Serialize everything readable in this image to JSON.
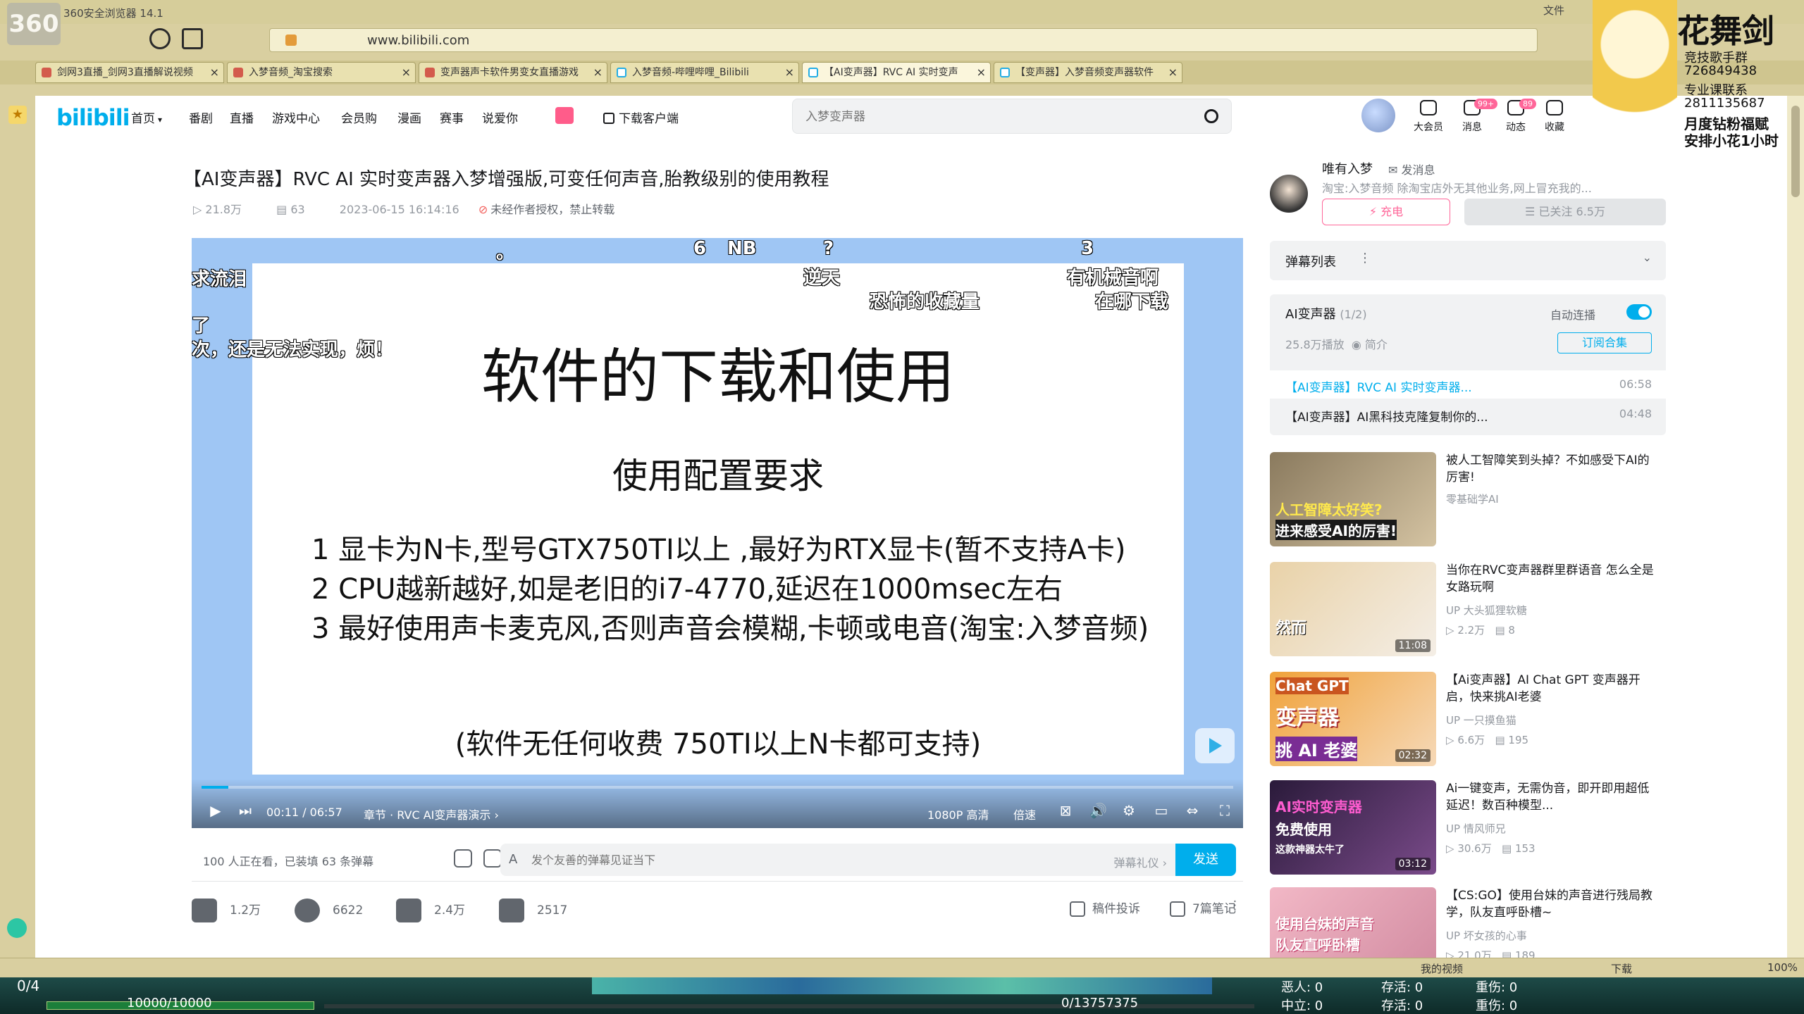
{
  "browser": {
    "app_title": "360安全浏览器 14.1",
    "url": "www.bilibili.com",
    "menu_file": "文件",
    "tabs": [
      {
        "label": "剑网3直播_剑网3直播解说视频"
      },
      {
        "label": "入梦音频_淘宝搜索"
      },
      {
        "label": "变声器声卡软件男变女直播游戏"
      },
      {
        "label": "入梦音频-哔哩哔哩_Bilibili"
      },
      {
        "label": "【AI变声器】RVC AI 实时变声"
      },
      {
        "label": "【变声器】入梦音频变声器软件"
      }
    ],
    "status_my_video": "我的视频",
    "status_download": "下载",
    "zoom": "100%"
  },
  "header": {
    "logo": "bilibili",
    "nav": [
      "首页",
      "番剧",
      "直播",
      "游戏中心",
      "会员购",
      "漫画",
      "赛事",
      "说爱你"
    ],
    "download_client": "下载客户端",
    "search_placeholder": "入梦变声器",
    "icons": [
      {
        "label": "大会员",
        "badge": ""
      },
      {
        "label": "消息",
        "badge": "99+"
      },
      {
        "label": "动态",
        "badge": "89"
      },
      {
        "label": "收藏",
        "badge": ""
      }
    ]
  },
  "video": {
    "title": "【AI变声器】RVC AI 实时变声器入梦增强版,可变任何声音,胎教级别的使用教程",
    "views": "21.8万",
    "danmaku_count": "63",
    "date": "2023-06-15 16:14:16",
    "copyright": "未经作者授权，禁止转载"
  },
  "slide": {
    "heading": "软件的下载和使用",
    "subheading": "使用配置要求",
    "lines": [
      "1 显卡为N卡,型号GTX750TI以上 ,最好为RTX显卡(暂不支持A卡)",
      "2 CPU越新越好,如是老旧的i7-4770,延迟在1000msec左右",
      "3 最好使用声卡麦克风,否则声音会模糊,卡顿或电音(淘宝:入梦音频)"
    ],
    "footer": "(软件无任何收费 750TI以上N卡都可支持)"
  },
  "danmaku": [
    "求流泪",
    "了",
    "次，还是无法实现，烦！",
    "6",
    "NB",
    "?",
    "逆天",
    "恐怖的收藏量",
    "3",
    "有机械音啊",
    "在哪下载",
    "。"
  ],
  "player": {
    "time_current": "00:11",
    "time_total": "06:57",
    "progress_fraction": 0.026,
    "chapter": "章节 · RVC AI变声器演示",
    "quality": "1080P 高清",
    "speed": "倍速"
  },
  "danmaku_bar": {
    "online": "100 人正在看，已装填 63 条弹幕",
    "input_placeholder": "发个友善的弹幕见证当下",
    "etiquette": "弹幕礼仪",
    "send": "发送"
  },
  "actions": {
    "like": "1.2万",
    "coin": "6622",
    "favorite": "2.4万",
    "share": "2517",
    "report": "稿件投诉",
    "notes": "7篇笔记"
  },
  "uploader": {
    "name": "唯有入梦",
    "message": "发消息",
    "desc": "淘宝:入梦音频 除淘宝店外无其他业务,网上冒充我的...",
    "charge": "充电",
    "follow": "已关注 6.5万"
  },
  "danmaku_list": {
    "title": "弹幕列表"
  },
  "collection": {
    "title": "AI变声器",
    "count": "(1/2)",
    "autoplay": "自动连播",
    "plays": "25.8万播放",
    "intro": "简介",
    "subscribe": "订阅合集",
    "episodes": [
      {
        "title": "【AI变声器】RVC AI 实时变声器...",
        "duration": "06:58",
        "current": true
      },
      {
        "title": "【AI变声器】AI黑科技克隆复制你的...",
        "duration": "04:48",
        "current": false
      }
    ]
  },
  "recommendations": [
    {
      "title": "被人工智障笑到头掉？不如感受下AI的厉害!",
      "author": "零基础学AI",
      "views": "",
      "danmaku": "",
      "duration": "",
      "cap1": "人工智障太好笑?",
      "cap2": "进来感受AI的厉害!"
    },
    {
      "title": "当你在RVC变声器群里群语音 怎么全是女路玩啊",
      "author": "大头狐狸软糖",
      "views": "2.2万",
      "danmaku": "8",
      "duration": "11:08",
      "cap1": "然而",
      "cap2": ""
    },
    {
      "title": "【Ai变声器】AI Chat GPT 变声器开启，快来挑AI老婆",
      "author": "一只摸鱼猫",
      "views": "6.6万",
      "danmaku": "195",
      "duration": "02:32",
      "cap1": "Chat GPT",
      "cap2": "变声器",
      "cap3": "挑 AI 老婆"
    },
    {
      "title": "Ai一键变声，无需伪音，即开即用超低延迟！数百种模型...",
      "author": "情风师兄",
      "views": "30.6万",
      "danmaku": "153",
      "duration": "03:12",
      "cap1": "AI实时变声器",
      "cap2": "免费使用",
      "cap3": "这款神器太牛了"
    },
    {
      "title": "【CS:GO】使用台妹的声音进行残局教学，队友直呼卧槽~",
      "author": "坏女孩的心事",
      "views": "21.0万",
      "danmaku": "189",
      "duration": "",
      "cap1": "使用台妹的声音",
      "cap2": "队友直呼卧槽"
    }
  ],
  "game": {
    "left_count": "0/4",
    "hp": "10000/10000",
    "center": "0/13757375",
    "evil_label": "恶人: 0",
    "neutral_label": "中立: 0",
    "save1": "存活: 0",
    "save2": "存活: 0",
    "dmg1": "重伤: 0",
    "dmg2": "重伤: 0"
  },
  "corner": {
    "brand": "花舞剑",
    "l1": "竞技歌手群",
    "l2": "726849438",
    "l3": "专业课联系",
    "l4": "2811135687",
    "l5": "月度钻粉福赋",
    "l6": "安排小花1小时"
  }
}
